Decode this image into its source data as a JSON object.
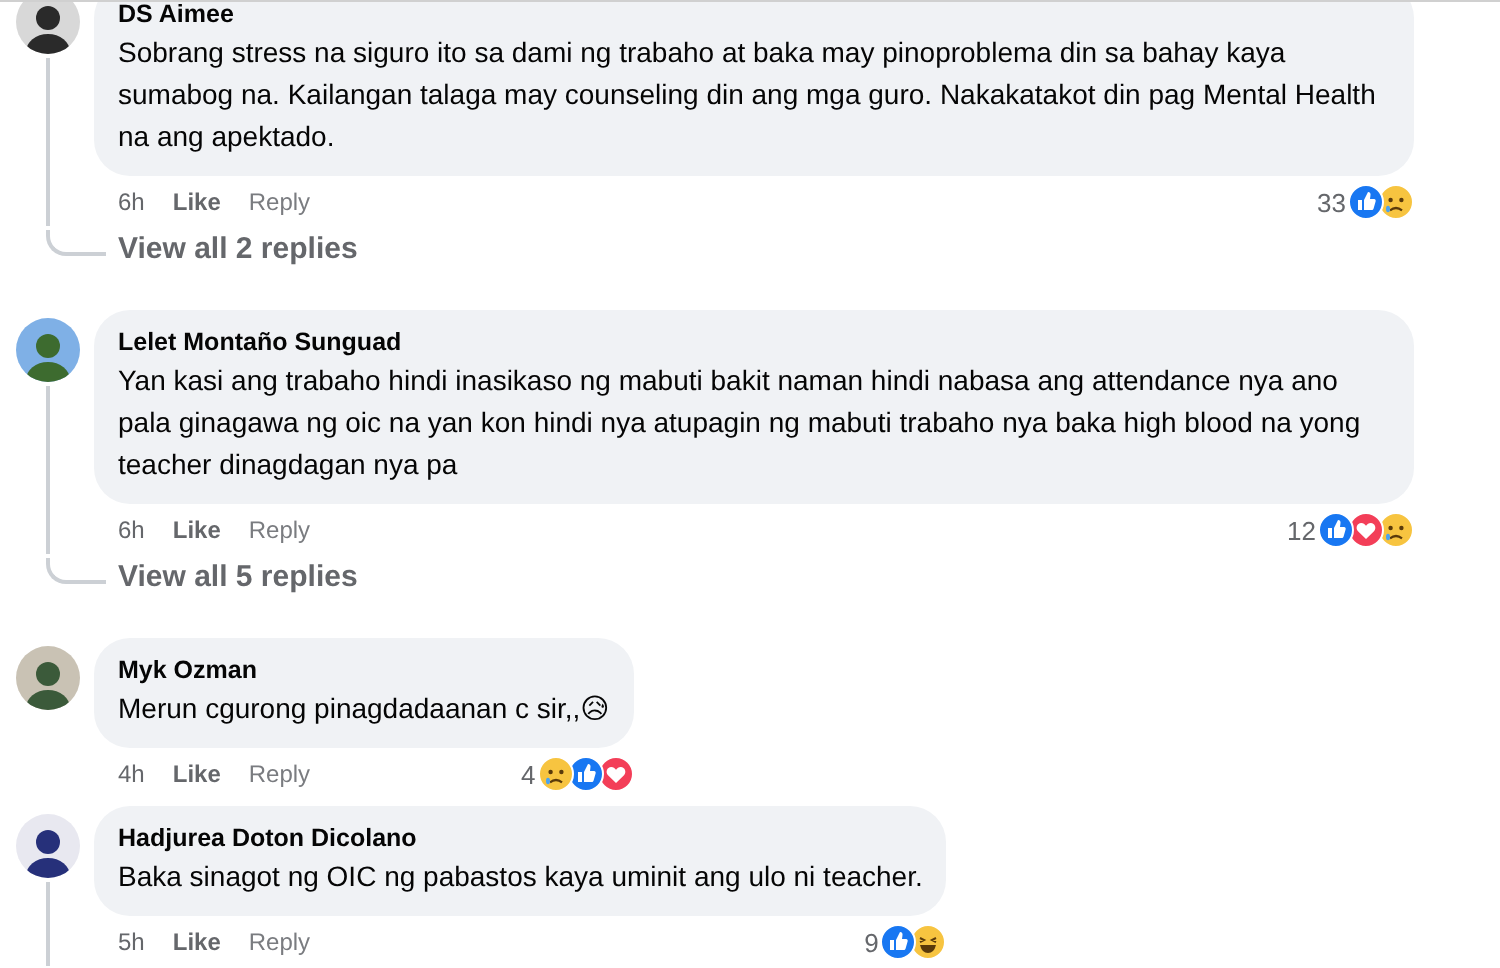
{
  "comments": [
    {
      "author": "DS Aimee",
      "text": "Sobrang stress na siguro ito sa dami ng trabaho at baka may pinoproblema din sa bahay kaya sumabog na. Kailangan talaga may counseling din ang mga guro. Nakakatakot din pag Mental Health na ang apektado.",
      "time": "6h",
      "like": "Like",
      "reply": "Reply",
      "reaction_count": "33",
      "reactions": [
        {
          "kind": "like"
        },
        {
          "kind": "sad"
        }
      ],
      "view_replies": "View all 2 replies",
      "thread": true
    },
    {
      "author": "Lelet Montaño Sunguad",
      "text": "Yan kasi ang trabaho hindi inasikaso ng mabuti bakit naman hindi nabasa ang attendance nya ano pala ginagawa ng oic na yan kon hindi nya atupagin ng mabuti trabaho nya baka high blood na yong teacher dinagdagan nya pa",
      "time": "6h",
      "like": "Like",
      "reply": "Reply",
      "reaction_count": "12",
      "reactions": [
        {
          "kind": "like"
        },
        {
          "kind": "love"
        },
        {
          "kind": "sad"
        }
      ],
      "view_replies": "View all 5 replies",
      "thread": true
    },
    {
      "author": "Myk Ozman",
      "text": "Merun cgurong pinagdadaanan c sir,,😥",
      "time": "4h",
      "like": "Like",
      "reply": "Reply",
      "reaction_count": "4",
      "reactions": [
        {
          "kind": "sad"
        },
        {
          "kind": "like"
        },
        {
          "kind": "love"
        }
      ],
      "thread": false
    },
    {
      "author": "Hadjurea Doton Dicolano",
      "text": "Baka sinagot ng OIC ng pabastos kaya uminit ang ulo ni teacher.",
      "time": "5h",
      "like": "Like",
      "reply": "Reply",
      "reaction_count": "9",
      "reactions": [
        {
          "kind": "like"
        },
        {
          "kind": "haha"
        }
      ],
      "thread": true
    }
  ]
}
